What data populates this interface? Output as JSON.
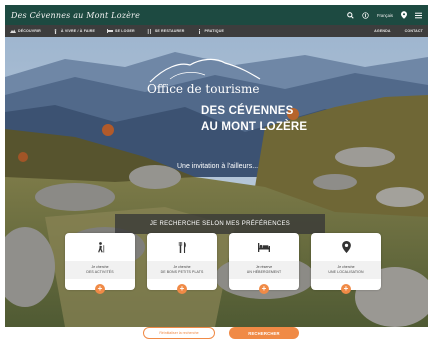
{
  "header": {
    "logo": "Des Cévennes au Mont Lozère",
    "lang": "Français",
    "icons": [
      "search-icon",
      "map-pin-icon",
      "user-icon",
      "menu-icon"
    ]
  },
  "nav": {
    "items": [
      "DÉCOUVRIR",
      "À VIVRE / À FAIRE",
      "SE LOGER",
      "SE RESTAURER",
      "PRATIQUE"
    ],
    "right": [
      "AGENDA",
      "CONTACT"
    ]
  },
  "hero": {
    "office": "Office de tourisme",
    "title_line1": "DES CÉVENNES",
    "title_line2": "AU MONT LOZÈRE",
    "tagline": "Une invitation à l'ailleurs..."
  },
  "search": {
    "title": "JE RECHERCHE SELON MES PRÉFÉRENCES",
    "cards": [
      {
        "icon": "hiker-icon",
        "line1": "Je cherche",
        "line2": "DES ACTIVITÉS"
      },
      {
        "icon": "cutlery-icon",
        "line1": "Je cherche",
        "line2": "DE BONS PETITS PLATS"
      },
      {
        "icon": "bed-icon",
        "line1": "Je réserve",
        "line2": "UN HÉBERGEMENT"
      },
      {
        "icon": "map-marker-icon",
        "line1": "Je cherche",
        "line2": "UNE LOCALISATION"
      }
    ],
    "plus": "+",
    "reset_label": "Réinitialiser la recherche",
    "submit_label": "RECHERCHER"
  },
  "colors": {
    "header_bg": "#1d4a41",
    "nav_bg": "#3d3d3d",
    "accent": "#f08a46"
  }
}
